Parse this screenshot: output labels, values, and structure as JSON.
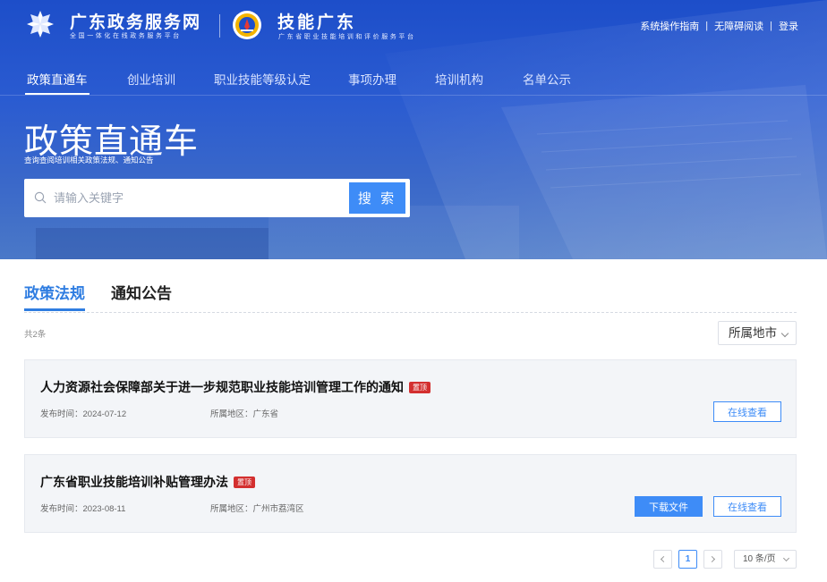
{
  "header": {
    "site_name": "广东政务服务网",
    "site_sub": "全国一体化在线政务服务平台",
    "brand_name": "技能广东",
    "brand_sub": "广东省职业技能培训和评价服务平台",
    "links": [
      "系统操作指南",
      "无障碍阅读",
      "登录"
    ],
    "link_separator": "|"
  },
  "nav": {
    "items": [
      "政策直通车",
      "创业培训",
      "职业技能等级认定",
      "事项办理",
      "培训机构",
      "名单公示"
    ],
    "active_index": 0
  },
  "hero": {
    "title": "政策直通车",
    "subtitle": "查询查阅培训相关政策法规、通知公告"
  },
  "search": {
    "placeholder": "请输入关键字",
    "value": "",
    "button_label": "搜 索"
  },
  "tabs": {
    "items": [
      "政策法规",
      "通知公告"
    ],
    "active_index": 0
  },
  "list": {
    "count_text": "共2条",
    "city_filter_label": "所属地市",
    "items": [
      {
        "title": "人力资源社会保障部关于进一步规范职业技能培训管理工作的通知",
        "pin_label": "置顶",
        "time_label": "发布时间：",
        "time": "2024-07-12",
        "region_label": "所属地区：",
        "region": "广东省",
        "view_label": "在线查看"
      },
      {
        "title": "广东省职业技能培训补贴管理办法",
        "pin_label": "置顶",
        "time_label": "发布时间：",
        "time": "2023-08-11",
        "region_label": "所属地区：",
        "region": "广州市荔湾区",
        "download_label": "下载文件",
        "view_label": "在线查看"
      }
    ]
  },
  "pagination": {
    "current_page": "1",
    "page_size_label": "10 条/页"
  },
  "colors": {
    "accent": "#3e8cf7",
    "tab_active": "#2f7de1",
    "pin": "#d32f2f",
    "hero": "#2a5bd1"
  },
  "icons": [
    "gov-service-logo-icon",
    "skills-guangdong-emblem-icon",
    "search-icon",
    "chevron-down-icon",
    "chevron-left-icon",
    "chevron-right-icon"
  ]
}
